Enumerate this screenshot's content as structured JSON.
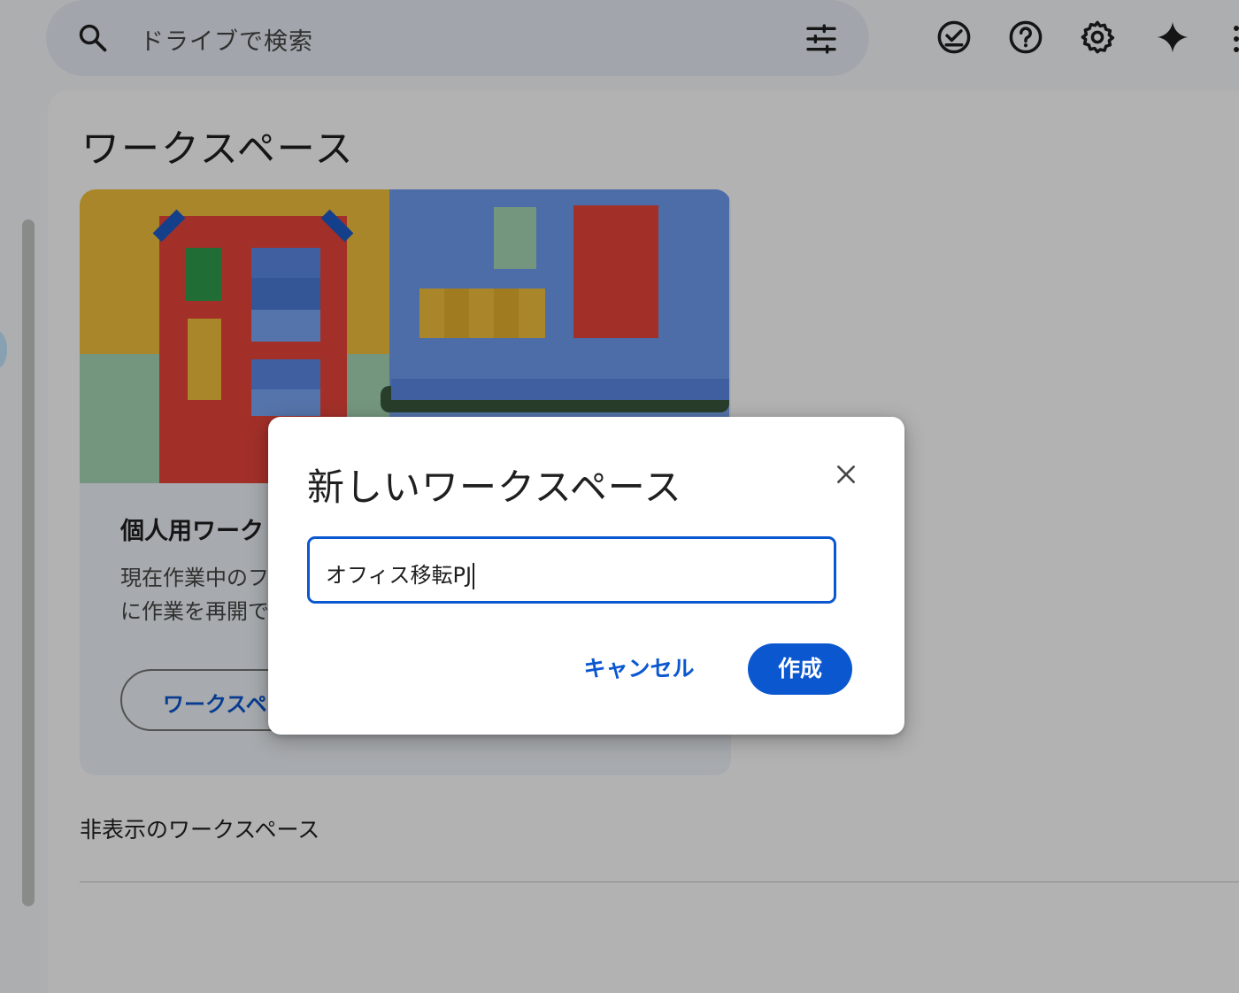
{
  "search": {
    "placeholder": "ドライブで検索"
  },
  "toolbar": {
    "icons": [
      "search-icon",
      "tune-icon",
      "offline-ready-icon",
      "help-icon",
      "settings-icon",
      "gemini-sparkle-icon",
      "more-vert-icon"
    ]
  },
  "page": {
    "title": "ワークスペース",
    "hidden_section_title": "非表示のワークスペース"
  },
  "card": {
    "title": "個人用ワーク",
    "description_line1": "現在作業中のフ",
    "description_line2": "に作業を再開で",
    "button_label": "ワークスペ"
  },
  "dialog": {
    "title": "新しいワークスペース",
    "input_value": "オフィス移転PJ",
    "cancel_label": "キャンセル",
    "create_label": "作成"
  },
  "colors": {
    "accent": "#0b57d0",
    "scrim": "rgba(0,0,0,0.30)",
    "search_bg": "#e9eef6"
  }
}
